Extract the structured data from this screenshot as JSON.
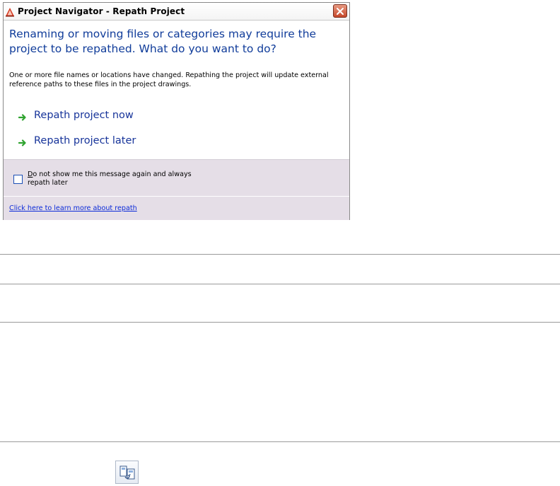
{
  "dialog": {
    "title": "Project Navigator - Repath Project",
    "heading": "Renaming or moving files or categories may require the project to be repathed. What do you want to do?",
    "description": "One or more file names or locations have changed. Repathing the project will update external reference paths to these files in the project drawings.",
    "options": [
      {
        "label": "Repath project now",
        "icon": "green-arrow-icon"
      },
      {
        "label": "Repath project later",
        "icon": "green-arrow-icon"
      }
    ],
    "checkbox": {
      "checked": false,
      "mnemonic": "D",
      "label_rest": "o not show me this message again and always repath later"
    },
    "learn_more_link": "Click here to learn more about repath"
  },
  "colors": {
    "heading": "#103c9a",
    "option_text": "#17349a",
    "arrow": "#2fa32f",
    "footer_band": "#e5dee7",
    "link": "#0b2ad8",
    "close_button": "#c6482b"
  },
  "icons": {
    "app": "autocad-app-icon",
    "close": "close-icon",
    "toolbar_tool": "repath-project-tool-icon"
  }
}
